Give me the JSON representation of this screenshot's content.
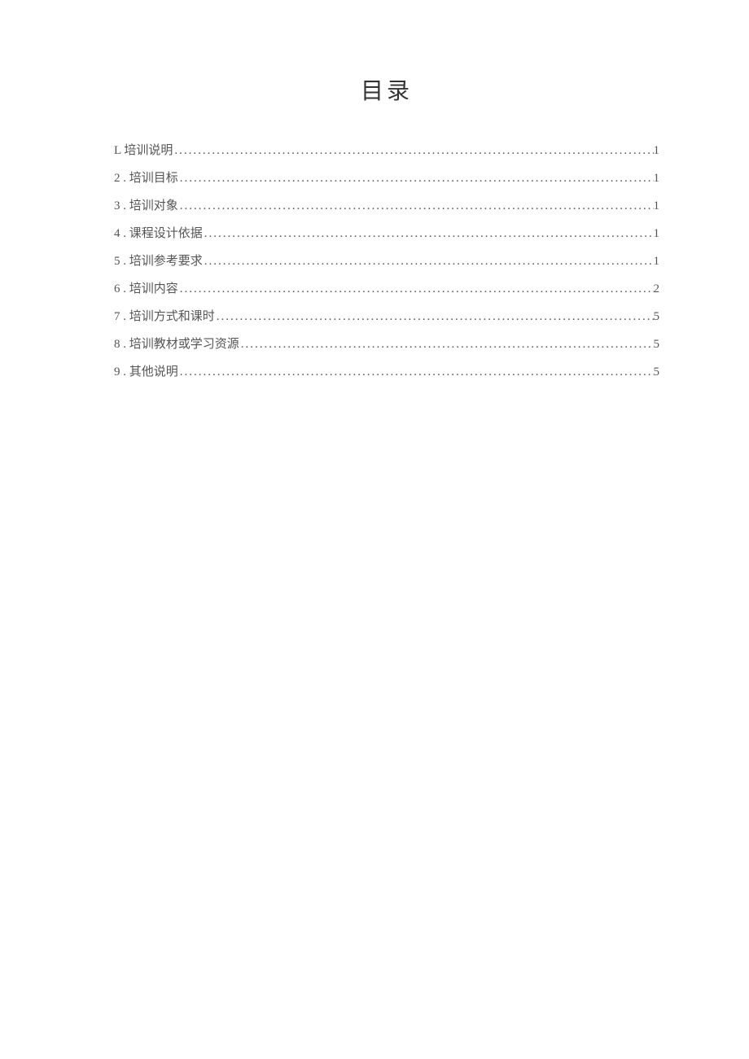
{
  "title": "目录",
  "toc": [
    {
      "label": "L 培训说明",
      "page": "1"
    },
    {
      "label": "2  . 培训目标",
      "page": "1"
    },
    {
      "label": "3  . 培训对象",
      "page": "1"
    },
    {
      "label": "4  . 课程设计依据 ",
      "page": "1"
    },
    {
      "label": "5  . 培训参考要求",
      "page": "1"
    },
    {
      "label": "6  . 培训内容 ",
      "page": "2"
    },
    {
      "label": "7  . 培训方式和课时",
      "page": "5"
    },
    {
      "label": "8  . 培训教材或学习资源",
      "page": "5"
    },
    {
      "label": "9  . 其他说明",
      "page": "5"
    }
  ]
}
